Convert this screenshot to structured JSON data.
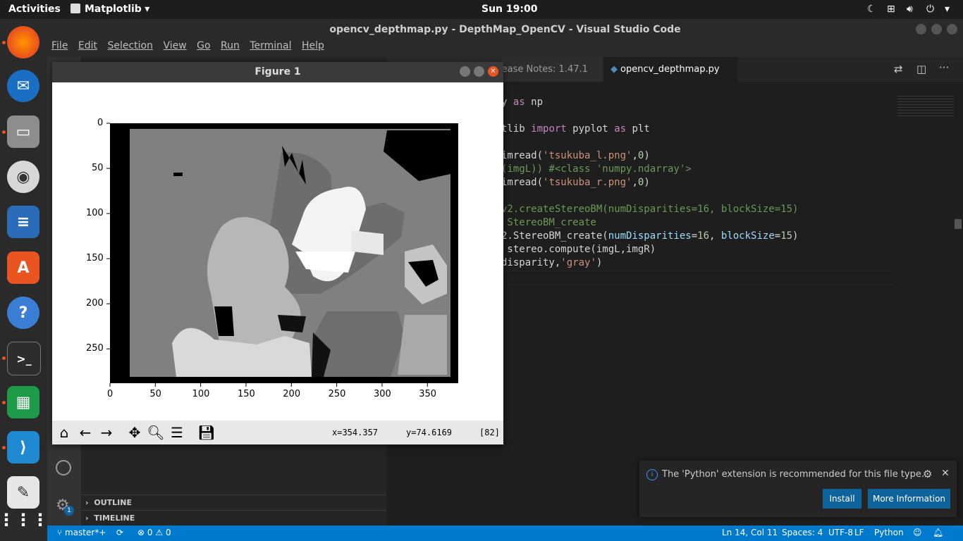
{
  "topbar": {
    "activities": "Activities",
    "app_menu": "Matplotlib",
    "clock": "Sun 19:00"
  },
  "vscode": {
    "window_title": "opencv_depthmap.py - DepthMap_OpenCV - Visual Studio Code",
    "menu": [
      "File",
      "Edit",
      "Selection",
      "View",
      "Go",
      "Run",
      "Terminal",
      "Help"
    ],
    "tabs": [
      {
        "label": "lease Notes: 1.47.1",
        "active": false
      },
      {
        "label": "opencv_depthmap.py",
        "active": true
      }
    ],
    "sidebar_sections": [
      "OUTLINE",
      "TIMELINE"
    ],
    "settings_badge": "1",
    "code_lines": [
      "y as np",
      "",
      "tlib import pyplot as plt",
      "",
      "imread('tsukuba_l.png',0)",
      "(imgL)) #<class 'numpy.ndarray'>",
      "imread('tsukuba_r.png',0)",
      "",
      "v2.createStereoBM(numDisparities=16, blockSize=15)",
      " StereoBM_create",
      "2.StereoBM_create(numDisparities=16, blockSize=15)",
      " stereo.compute(imgL,imgR)",
      "disparity,'gray')"
    ],
    "status": {
      "branch": "master*+",
      "errors": "0",
      "warnings": "0",
      "position": "Ln 14, Col 11",
      "spaces": "Spaces: 4",
      "encoding": "UTF-8",
      "eol": "LF",
      "language": "Python"
    },
    "notification": {
      "message": "The 'Python' extension is recommended for this file type.",
      "install": "Install",
      "more": "More Information"
    }
  },
  "matplotlib": {
    "window_title": "Figure 1",
    "x_ticks": [
      "0",
      "50",
      "100",
      "150",
      "200",
      "250",
      "300",
      "350"
    ],
    "y_ticks": [
      "0",
      "50",
      "100",
      "150",
      "200",
      "250"
    ],
    "coord_x": "x=354.357",
    "coord_y": "y=74.6169",
    "pixel_value": "[82]"
  },
  "colors": {
    "status_bar": "#007acc",
    "ubuntu_accent": "#e95420"
  }
}
